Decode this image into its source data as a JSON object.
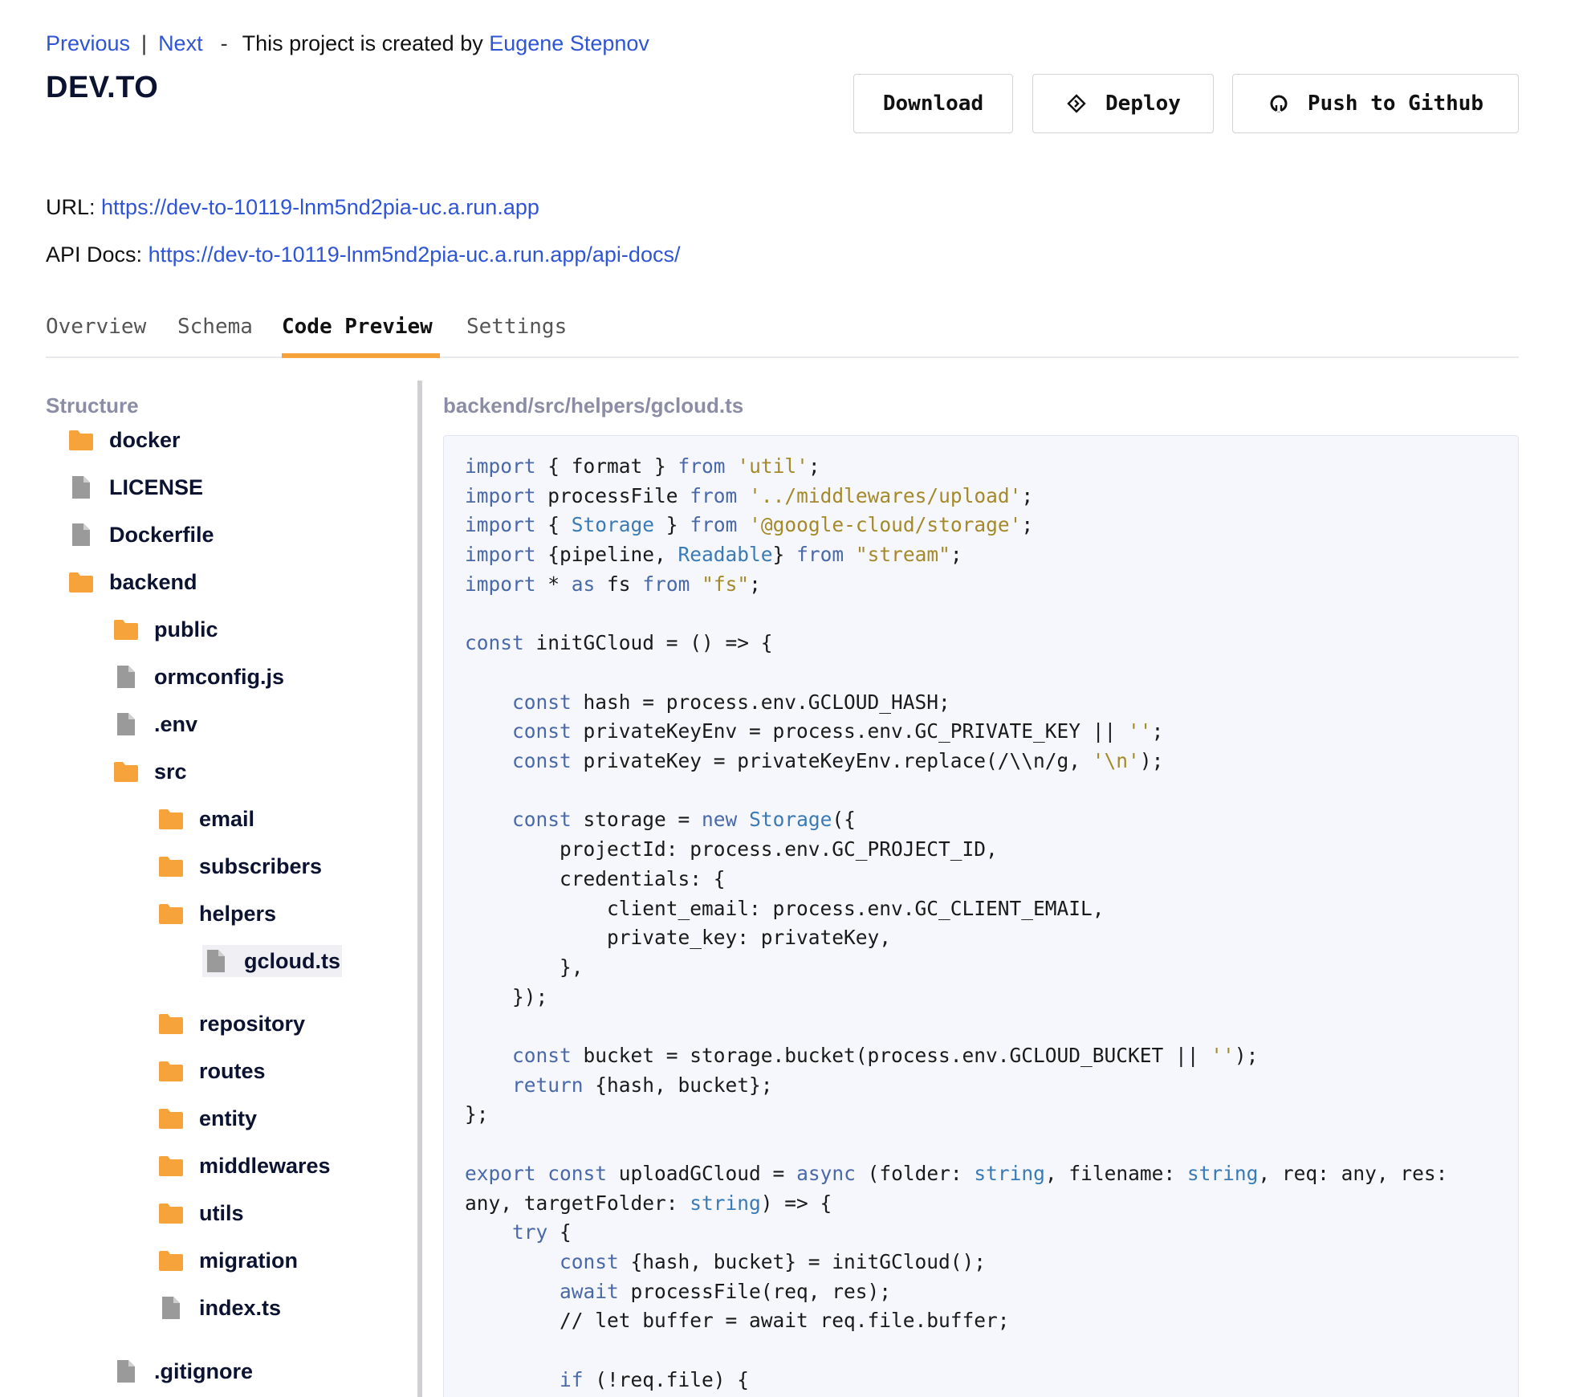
{
  "nav": {
    "previous": "Previous",
    "separator": "|",
    "next": "Next",
    "dash": "-",
    "created_text": "This project is created by",
    "author": "Eugene Stepnov"
  },
  "project": {
    "title": "DEV.TO"
  },
  "actions": {
    "download": "Download",
    "deploy": "Deploy",
    "push": "Push to Github"
  },
  "links": {
    "url_label": "URL:",
    "url": "https://dev-to-10119-lnm5nd2pia-uc.a.run.app",
    "api_label": "API Docs:",
    "api_url": "https://dev-to-10119-lnm5nd2pia-uc.a.run.app/api-docs/"
  },
  "tabs": [
    {
      "label": "Overview",
      "active": false
    },
    {
      "label": "Schema",
      "active": false
    },
    {
      "label": "Code Preview",
      "active": true
    },
    {
      "label": "Settings",
      "active": false
    }
  ],
  "structure": {
    "heading": "Structure",
    "items": [
      {
        "name": "docker",
        "type": "folder"
      },
      {
        "name": "LICENSE",
        "type": "file"
      },
      {
        "name": "Dockerfile",
        "type": "file"
      },
      {
        "name": "backend",
        "type": "folder"
      },
      {
        "name": "public",
        "type": "folder"
      },
      {
        "name": "ormconfig.js",
        "type": "file"
      },
      {
        "name": ".env",
        "type": "file"
      },
      {
        "name": "src",
        "type": "folder"
      },
      {
        "name": "email",
        "type": "folder"
      },
      {
        "name": "subscribers",
        "type": "folder"
      },
      {
        "name": "helpers",
        "type": "folder"
      },
      {
        "name": "gcloud.ts",
        "type": "file",
        "selected": true
      },
      {
        "name": "repository",
        "type": "folder"
      },
      {
        "name": "routes",
        "type": "folder"
      },
      {
        "name": "entity",
        "type": "folder"
      },
      {
        "name": "middlewares",
        "type": "folder"
      },
      {
        "name": "utils",
        "type": "folder"
      },
      {
        "name": "migration",
        "type": "folder"
      },
      {
        "name": "index.ts",
        "type": "file"
      },
      {
        "name": ".gitignore",
        "type": "file"
      }
    ]
  },
  "code": {
    "path": "backend/src/helpers/gcloud.ts",
    "lines": [
      "import { format } from 'util';",
      "import processFile from '../middlewares/upload';",
      "import { Storage } from '@google-cloud/storage';",
      "import {pipeline, Readable} from \"stream\";",
      "import * as fs from \"fs\";",
      "",
      "const initGCloud = () => {",
      "",
      "    const hash = process.env.GCLOUD_HASH;",
      "    const privateKeyEnv = process.env.GC_PRIVATE_KEY || '';",
      "    const privateKey = privateKeyEnv.replace(/\\\\n/g, '\\n');",
      "",
      "    const storage = new Storage({",
      "        projectId: process.env.GC_PROJECT_ID,",
      "        credentials: {",
      "            client_email: process.env.GC_CLIENT_EMAIL,",
      "            private_key: privateKey,",
      "        },",
      "    });",
      "",
      "    const bucket = storage.bucket(process.env.GCLOUD_BUCKET || '');",
      "    return {hash, bucket};",
      "};",
      "",
      "export const uploadGCloud = async (folder: string, filename: string, req: any, res:",
      "any, targetFolder: string) => {",
      "    try {",
      "        const {hash, bucket} = initGCloud();",
      "        await processFile(req, res);",
      "        // let buffer = await req.file.buffer;",
      "",
      "        if (!req.file) {"
    ]
  },
  "colors": {
    "link": "#2f55d4",
    "tab_active_underline": "#f5a33a",
    "folder_icon": "#f5a33a",
    "file_icon": "#9a9a9a",
    "code_keyword": "#4a69a8",
    "code_type": "#3a7bb5",
    "code_string": "#a48a2a",
    "code_background": "#f6f7fc"
  }
}
